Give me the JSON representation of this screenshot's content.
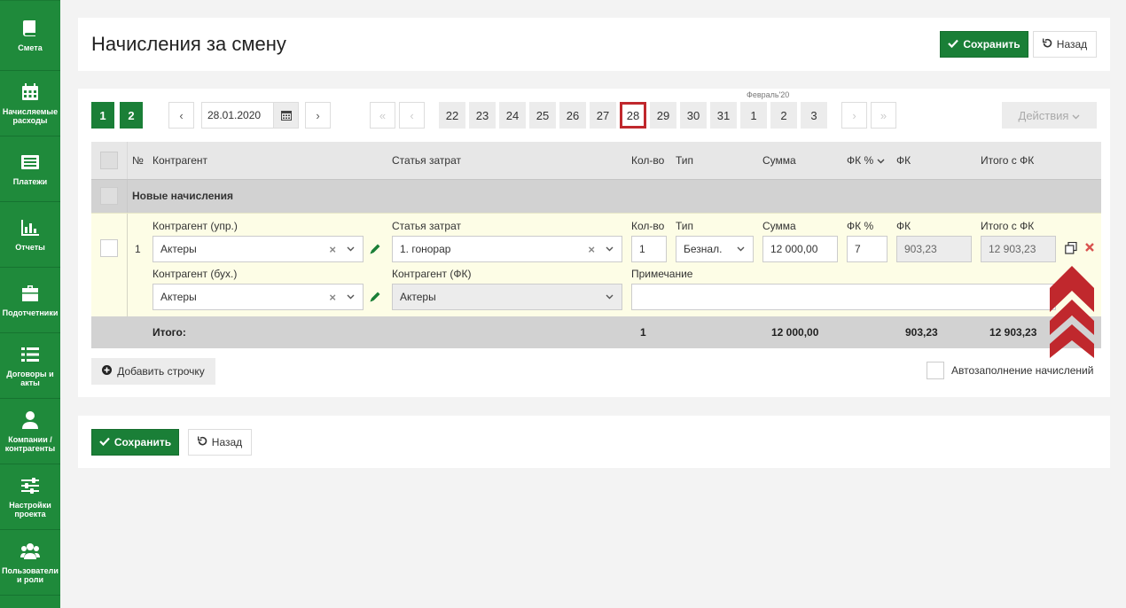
{
  "sidebar": {
    "items": [
      {
        "label": "Смета",
        "icon": "book-icon"
      },
      {
        "label": "Начисляемые расходы",
        "icon": "calendar-icon"
      },
      {
        "label": "Платежи",
        "icon": "list-card-icon"
      },
      {
        "label": "Отчеты",
        "icon": "bar-chart-icon"
      },
      {
        "label": "Подотчетники",
        "icon": "briefcase-icon"
      },
      {
        "label": "Договоры и акты",
        "icon": "list-icon"
      },
      {
        "label": "Компании / контрагенты",
        "icon": "user-icon"
      },
      {
        "label": "Настройки проекта",
        "icon": "sliders-icon"
      },
      {
        "label": "Пользователи и роли",
        "icon": "users-icon"
      }
    ]
  },
  "header": {
    "title": "Начисления за смену",
    "save_label": "Сохранить",
    "back_label": "Назад"
  },
  "pager": {
    "shift_pages": [
      "1",
      "2"
    ],
    "prev": "‹",
    "next": "›",
    "first": "«",
    "last": "»",
    "date_value": "28.01.2020",
    "month_label": "Февраль'20",
    "days": [
      "22",
      "23",
      "24",
      "25",
      "26",
      "27",
      "28",
      "29",
      "30",
      "31",
      "1",
      "2",
      "3"
    ],
    "active_day": "28",
    "actions_label": "Действия"
  },
  "table": {
    "headers": {
      "num": "№",
      "counterparty": "Контрагент",
      "cost_item": "Статья затрат",
      "qty": "Кол-во",
      "type": "Тип",
      "sum": "Сумма",
      "fk_pct": "ФК %",
      "fk": "ФК",
      "total_fk": "Итого с ФК"
    },
    "group_label": "Новые начисления",
    "row": {
      "num": "1",
      "label_cp_mgmt": "Контрагент (упр.)",
      "cp_mgmt": "Актеры",
      "label_cost_item": "Статья затрат",
      "cost_item": "1. гонорар",
      "label_qty": "Кол-во",
      "qty": "1",
      "label_type": "Тип",
      "type": "Безнал.",
      "label_sum": "Сумма",
      "sum": "12 000,00",
      "label_fk_pct": "ФК %",
      "fk_pct": "7",
      "label_fk": "ФК",
      "fk": "903,23",
      "label_total_fk": "Итого с ФК",
      "total_fk": "12 903,23",
      "label_cp_acc": "Контрагент (бух.)",
      "cp_acc": "Актеры",
      "label_cp_fk": "Контрагент (ФК)",
      "cp_fk": "Актеры",
      "label_note": "Примечание",
      "note": ""
    },
    "totals": {
      "label": "Итого:",
      "qty": "1",
      "sum": "12 000,00",
      "fk": "903,23",
      "total_fk": "12 903,23"
    }
  },
  "add_row_label": "Добавить строчку",
  "autofill_label": "Автозаполнение начислений",
  "footer": {
    "save_label": "Сохранить",
    "back_label": "Назад"
  },
  "colors": {
    "sidebar": "#1f8a3b",
    "primary": "#1a7f37",
    "active_day_border": "#c0282d",
    "row_bg": "#fdfde6",
    "scroll_arrow": "#c0282d"
  }
}
